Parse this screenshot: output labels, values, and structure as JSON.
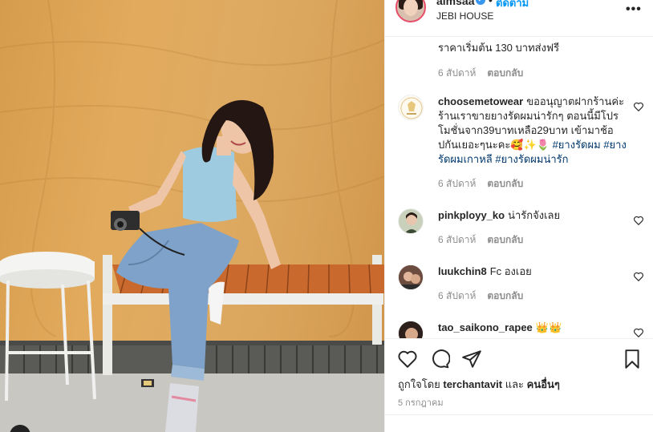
{
  "post": {
    "username": "aimsaa",
    "verified_mark": "✔",
    "separator": "•",
    "follow_label": "ติดตาม",
    "location": "JEBI HOUSE",
    "more_label": "•••"
  },
  "first_reply": {
    "text": "ราคาเริ่มต้น 130 บาทส่งฟรี",
    "date": "6 สัปดาห์",
    "reply_label": "ตอบกลับ"
  },
  "comments": [
    {
      "user": "choosemetowear",
      "text": "ขออนุญาตฝากร้านค่ะ ร้านเราขายยางรัดผมน่ารักๆ ตอนนี้มีโปรโมชั่นจาก39บาทเหลือ29บาท เข้ามาช้อปกันเยอะๆนะคะ🥰✨🌷",
      "tags": [
        "#ยางรัดผม",
        "#ยางรัดผมเกาหลี",
        "#ยางรัดผมน่ารัก"
      ],
      "date": "6 สัปดาห์",
      "reply_label": "ตอบกลับ"
    },
    {
      "user": "pinkployy_ko",
      "text": "น่ารักจังเลย",
      "date": "6 สัปดาห์",
      "reply_label": "ตอบกลับ"
    },
    {
      "user": "luukchin8",
      "text": "Fc องเอย",
      "date": "6 สัปดาห์",
      "reply_label": "ตอบกลับ"
    },
    {
      "user": "tao_saikono_rapee",
      "text": "👑👑",
      "date": "",
      "reply_label": ""
    }
  ],
  "actions": {
    "like_icon": "heart-icon",
    "comment_icon": "comment-icon",
    "share_icon": "share-icon",
    "save_icon": "bookmark-icon"
  },
  "likes": {
    "prefix": "ถูกใจโดย",
    "user": "terchantavit",
    "conj": "และ",
    "others": "คนอื่นๆ"
  },
  "post_date": "5 กรกฎาคม",
  "colors": {
    "link_blue": "#0095f6",
    "hashtag": "#00376b",
    "muted": "#8e8e8e",
    "wall": "#e2aa5c"
  }
}
